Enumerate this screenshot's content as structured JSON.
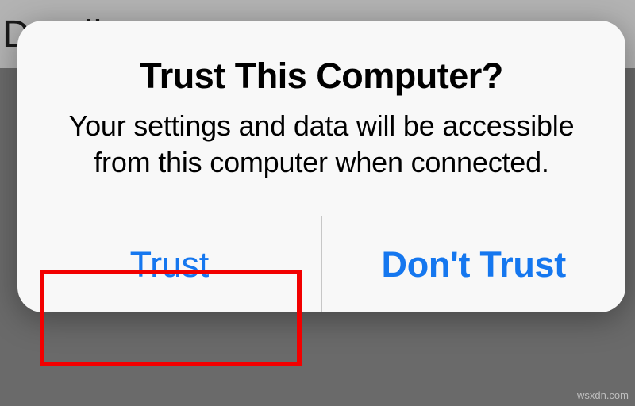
{
  "background": {
    "header_text": "e Details"
  },
  "alert": {
    "title": "Trust This Computer?",
    "message": "Your settings and data will be accessible from this computer when connected.",
    "trust_label": "Trust",
    "dont_trust_label": "Don't Trust"
  },
  "watermark": "wsxdn.com"
}
